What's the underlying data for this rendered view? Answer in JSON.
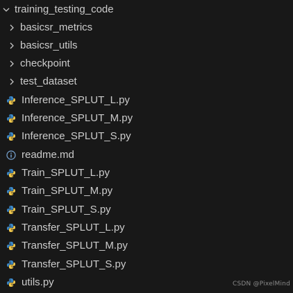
{
  "explorer": {
    "root": {
      "label": "training_testing_code",
      "state": "expanded",
      "icon": "chevron-down-icon"
    },
    "folders": [
      {
        "label": "basicsr_metrics",
        "icon": "chevron-right-icon"
      },
      {
        "label": "basicsr_utils",
        "icon": "chevron-right-icon"
      },
      {
        "label": "checkpoint",
        "icon": "chevron-right-icon"
      },
      {
        "label": "test_dataset",
        "icon": "chevron-right-icon"
      }
    ],
    "files": [
      {
        "label": "Inference_SPLUT_L.py",
        "icon": "python-icon"
      },
      {
        "label": "Inference_SPLUT_M.py",
        "icon": "python-icon"
      },
      {
        "label": "Inference_SPLUT_S.py",
        "icon": "python-icon"
      },
      {
        "label": "readme.md",
        "icon": "info-icon"
      },
      {
        "label": "Train_SPLUT_L.py",
        "icon": "python-icon"
      },
      {
        "label": "Train_SPLUT_M.py",
        "icon": "python-icon"
      },
      {
        "label": "Train_SPLUT_S.py",
        "icon": "python-icon"
      },
      {
        "label": "Transfer_SPLUT_L.py",
        "icon": "python-icon"
      },
      {
        "label": "Transfer_SPLUT_M.py",
        "icon": "python-icon"
      },
      {
        "label": "Transfer_SPLUT_S.py",
        "icon": "python-icon"
      },
      {
        "label": "utils.py",
        "icon": "python-icon"
      }
    ]
  },
  "watermark": "CSDN @PixelMind",
  "colors": {
    "background": "#181818",
    "text": "#cccccc",
    "python_blue": "#3b87c6",
    "python_yellow": "#f2c94c",
    "info_blue": "#7aa7d6"
  }
}
